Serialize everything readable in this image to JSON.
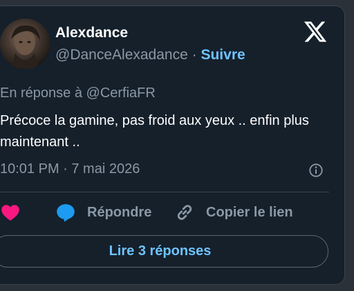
{
  "tweet": {
    "author_name": "Alexdance",
    "author_handle": "@DanceAlexadance",
    "separator": "·",
    "follow_label": "Suivre",
    "reply_context": "En réponse à @CerfiaFR",
    "text": "Précoce la gamine, pas froid aux yeux .. enfin plus maintenant ..",
    "timestamp": "10:01 PM · 7 mai 2026"
  },
  "actions": {
    "reply_label": "Répondre",
    "copy_label": "Copier le lien",
    "read_replies_label": "Lire 3 réponses"
  },
  "icons": {
    "brand": "x-logo-icon",
    "info": "info-icon",
    "like": "heart-icon",
    "reply": "speech-bubble-icon",
    "copy": "link-icon"
  },
  "colors": {
    "background": "#15202b",
    "accent": "#6fc3ff",
    "like": "#f91880",
    "reply": "#1d9bf0",
    "muted": "#8b98a5"
  }
}
